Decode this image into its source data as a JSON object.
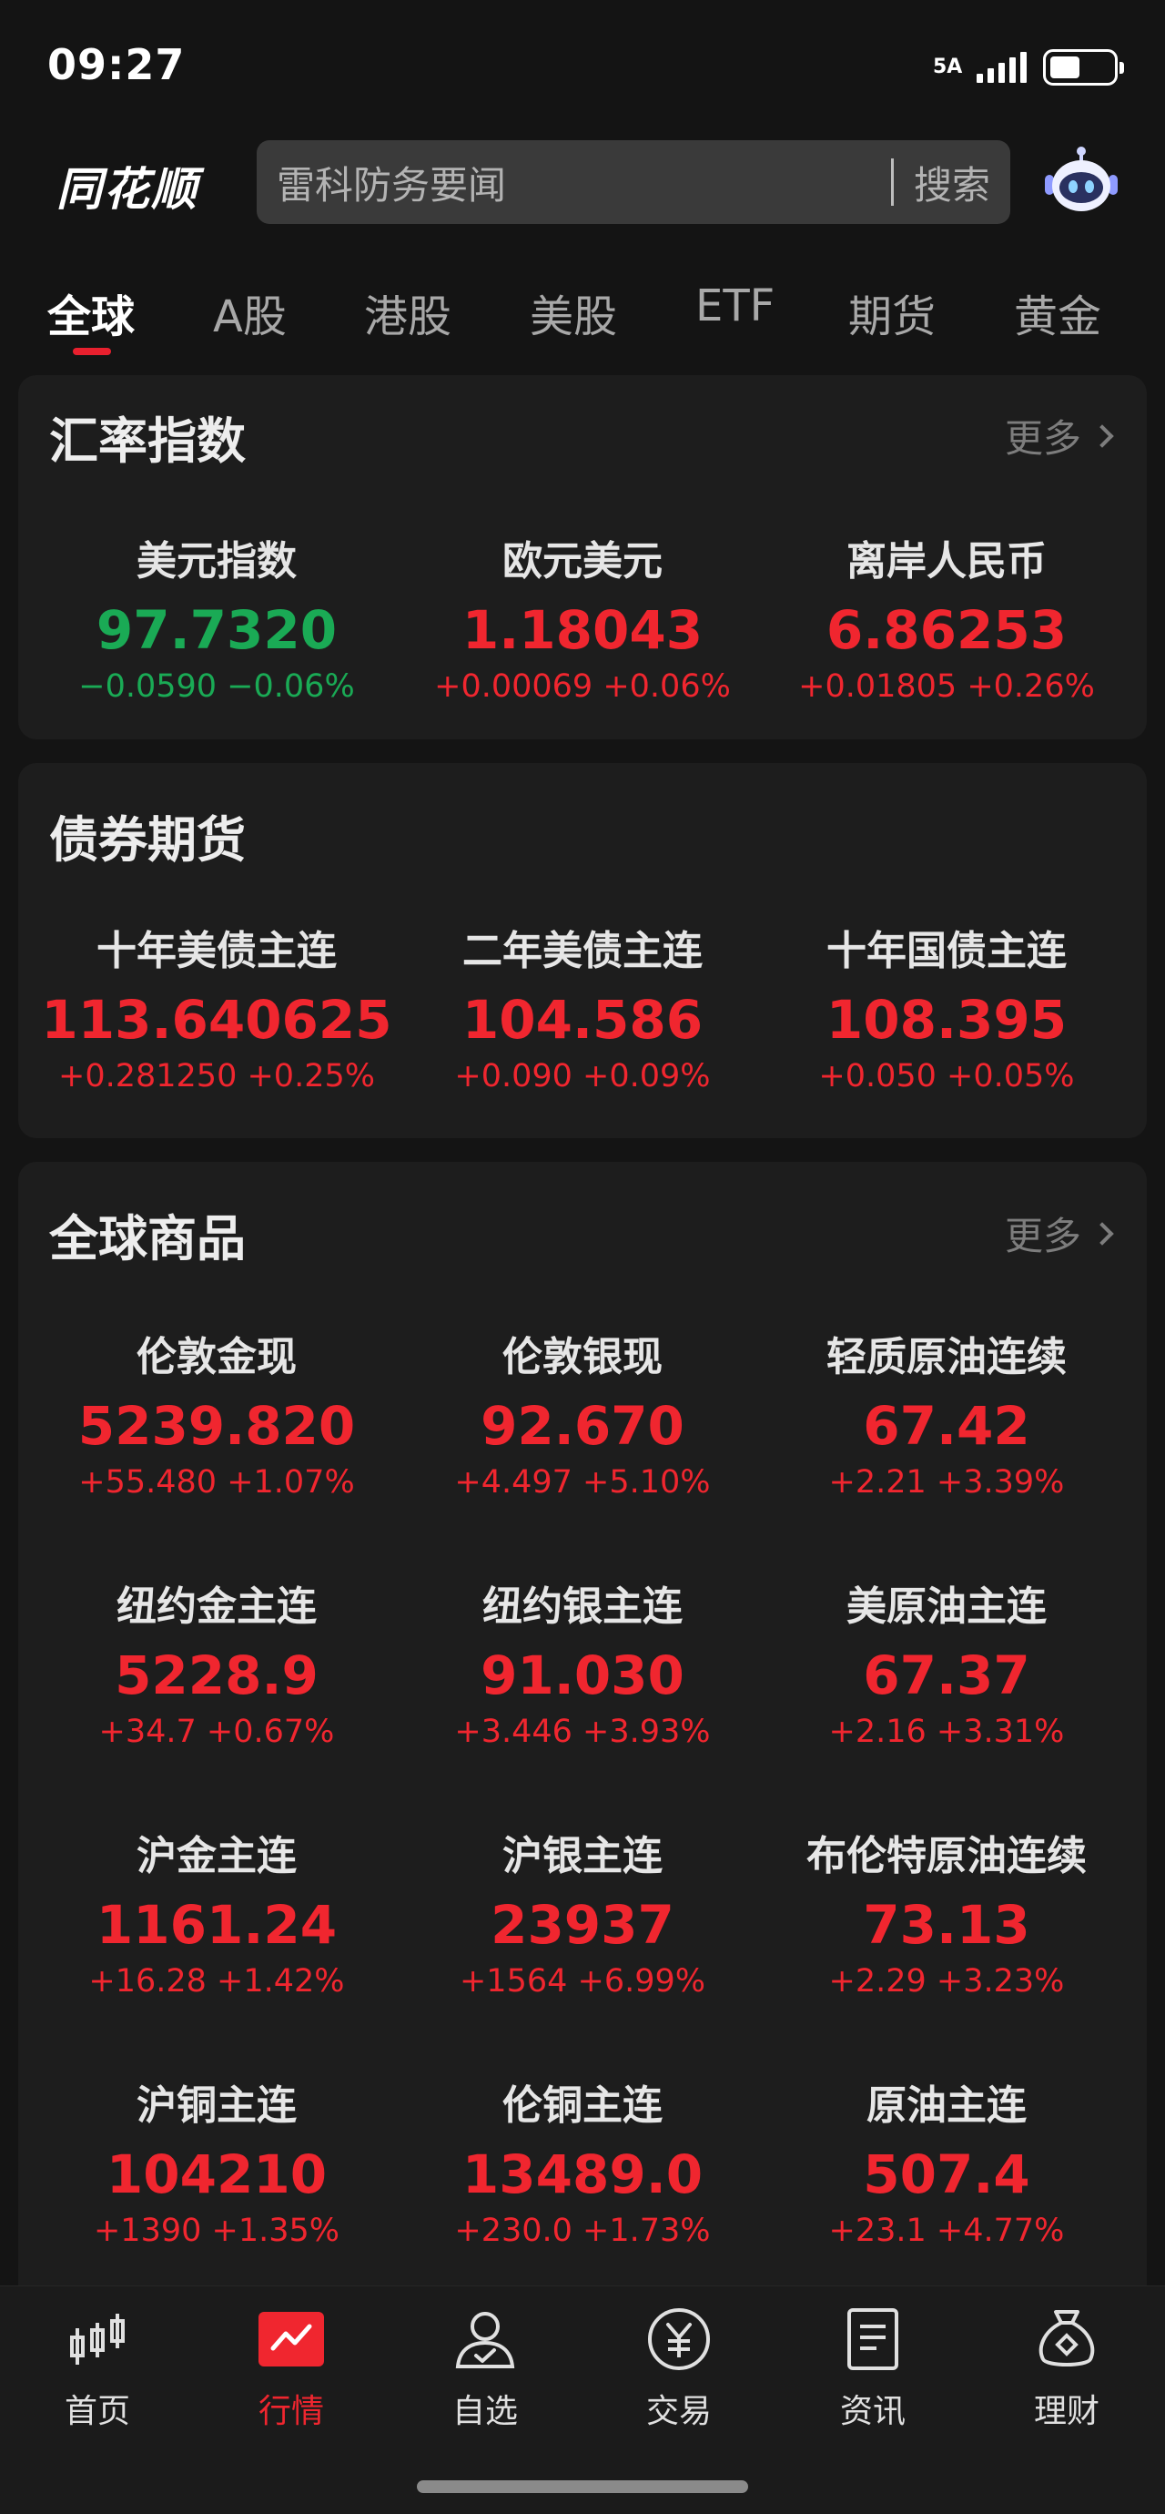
{
  "status_bar": {
    "time": "09:27",
    "network": "5A"
  },
  "header": {
    "logo": "同花顺",
    "search_placeholder": "雷科防务要闻",
    "search_button": "搜索"
  },
  "tabs": [
    {
      "label": "全球",
      "active": true
    },
    {
      "label": "A股"
    },
    {
      "label": "港股"
    },
    {
      "label": "美股"
    },
    {
      "label": "ETF"
    },
    {
      "label": "期货"
    },
    {
      "label": "黄金"
    }
  ],
  "sections": [
    {
      "title": "汇率指数",
      "more": "更多",
      "quotes": [
        {
          "name": "美元指数",
          "price": "97.7320",
          "change": "−0.0590 −0.06%",
          "direction": "down"
        },
        {
          "name": "欧元美元",
          "price": "1.18043",
          "change": "+0.00069 +0.06%",
          "direction": "up"
        },
        {
          "name": "离岸人民币",
          "price": "6.86253",
          "change": "+0.01805 +0.26%",
          "direction": "up"
        }
      ]
    },
    {
      "title": "债券期货",
      "quotes": [
        {
          "name": "十年美债主连",
          "price": "113.640625",
          "change": "+0.281250 +0.25%",
          "direction": "up"
        },
        {
          "name": "二年美债主连",
          "price": "104.586",
          "change": "+0.090 +0.09%",
          "direction": "up"
        },
        {
          "name": "十年国债主连",
          "price": "108.395",
          "change": "+0.050 +0.05%",
          "direction": "up"
        }
      ]
    },
    {
      "title": "全球商品",
      "more": "更多",
      "quotes": [
        {
          "name": "伦敦金现",
          "price": "5239.820",
          "change": "+55.480 +1.07%",
          "direction": "up"
        },
        {
          "name": "伦敦银现",
          "price": "92.670",
          "change": "+4.497 +5.10%",
          "direction": "up"
        },
        {
          "name": "轻质原油连续",
          "price": "67.42",
          "change": "+2.21 +3.39%",
          "direction": "up"
        },
        {
          "name": "纽约金主连",
          "price": "5228.9",
          "change": "+34.7 +0.67%",
          "direction": "up"
        },
        {
          "name": "纽约银主连",
          "price": "91.030",
          "change": "+3.446 +3.93%",
          "direction": "up"
        },
        {
          "name": "美原油主连",
          "price": "67.37",
          "change": "+2.16 +3.31%",
          "direction": "up"
        },
        {
          "name": "沪金主连",
          "price": "1161.24",
          "change": "+16.28 +1.42%",
          "direction": "up"
        },
        {
          "name": "沪银主连",
          "price": "23937",
          "change": "+1564 +6.99%",
          "direction": "up"
        },
        {
          "name": "布伦特原油连续",
          "price": "73.13",
          "change": "+2.29 +3.23%",
          "direction": "up"
        },
        {
          "name": "沪铜主连",
          "price": "104210",
          "change": "+1390 +1.35%",
          "direction": "up"
        },
        {
          "name": "伦铜主连",
          "price": "13489.0",
          "change": "+230.0 +1.73%",
          "direction": "up"
        },
        {
          "name": "原油主连",
          "price": "507.4",
          "change": "+23.1 +4.77%",
          "direction": "up"
        }
      ]
    }
  ],
  "colors": {
    "up": "#f0262f",
    "down": "#1aaa55",
    "accent": "#e8202e"
  },
  "bottom_nav": [
    {
      "label": "首页",
      "icon": "candlestick-icon"
    },
    {
      "label": "行情",
      "icon": "trend-chart-icon",
      "active": true
    },
    {
      "label": "自选",
      "icon": "user-check-icon"
    },
    {
      "label": "交易",
      "icon": "yuan-circle-icon"
    },
    {
      "label": "资讯",
      "icon": "document-icon"
    },
    {
      "label": "理财",
      "icon": "money-bag-icon"
    }
  ]
}
